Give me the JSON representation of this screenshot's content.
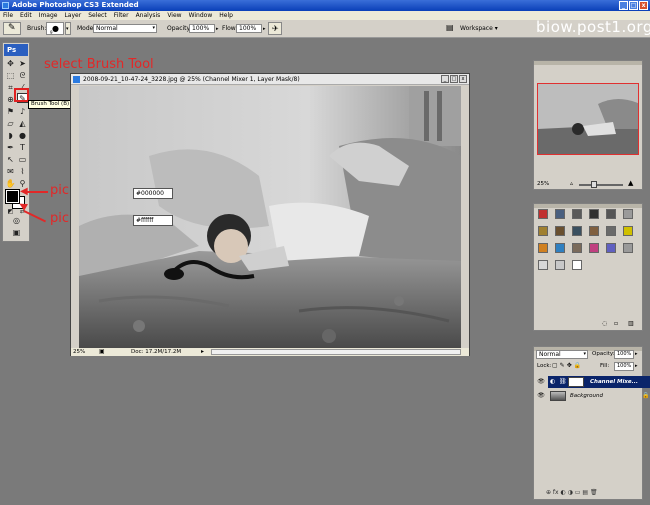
{
  "app": {
    "title": "Adobe Photoshop CS3 Extended",
    "win_min": "_",
    "win_max": "□",
    "win_close": "x"
  },
  "menu": [
    "File",
    "Edit",
    "Image",
    "Layer",
    "Select",
    "Filter",
    "Analysis",
    "View",
    "Window",
    "Help"
  ],
  "options_bar": {
    "brush_label": "Brush:",
    "brush_size": "9",
    "mode_label": "Mode:",
    "mode_value": "Normal",
    "opacity_label": "Opacity:",
    "opacity_value": "100%",
    "flow_label": "Flow:",
    "flow_value": "100%",
    "workspace_label": "Workspace ▾"
  },
  "watermark": "biow.post1.org",
  "toolbox": {
    "logo": "Ps",
    "tooltip": "Brush Tool (B)"
  },
  "annotations": {
    "select_brush": "select Brush Tool",
    "pick_black": "pick black",
    "pick_white": "pick white",
    "black_hex": "000000",
    "white_hex": "ffffff",
    "hash": "#"
  },
  "document": {
    "title": "2008-09-21_10-47-24_3228.jpg @ 25% (Channel Mixer 1, Layer Mask/8)",
    "zoom": "25%",
    "doc_info": "Doc: 17.2M/17.2M"
  },
  "navigator": {
    "zoom": "25%"
  },
  "styles": {
    "swatches": [
      "#c03030",
      "#4a6080",
      "#5a5a5a",
      "#303030",
      "#555555",
      "#9a9a9a",
      "#a08030",
      "#6a5030",
      "#3a5060",
      "#806040",
      "#6a6a6a",
      "#d0c000",
      "#d08020",
      "#3080c0",
      "#7a6a5a",
      "#c04080",
      "#6060c0",
      "#9a9a9a",
      "#d8d8d8",
      "#c8c8c8",
      "#ffffff"
    ]
  },
  "layers": {
    "blend_mode": "Normal",
    "opacity_label": "Opacity:",
    "opacity_value": "100%",
    "lock_label": "Lock:",
    "fill_label": "Fill:",
    "fill_value": "100%",
    "items": [
      {
        "name": "Channel Mixe...",
        "selected": true
      },
      {
        "name": "Background",
        "selected": false
      }
    ],
    "footer_icons": "⊕ fx ◐ ◑ ▭ ▤ 🗑"
  },
  "colors": {
    "accent": "#e22828",
    "selection": "#0a246a",
    "titlebar": "#0a3fb8"
  }
}
